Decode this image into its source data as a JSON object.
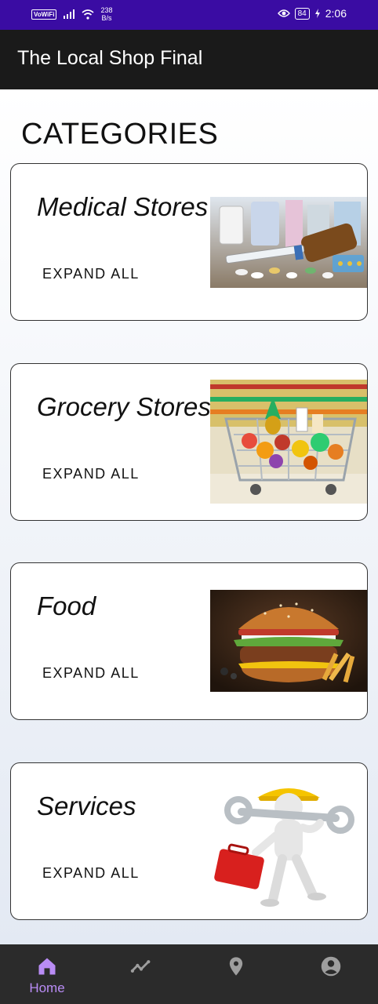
{
  "status_bar": {
    "wifi_badge": "VoWiFi",
    "speed_value": "238",
    "speed_unit": "B/s",
    "battery": "84",
    "time": "2:06"
  },
  "app_bar": {
    "title": "The Local Shop Final"
  },
  "section_title": "CATEGORIES",
  "categories": [
    {
      "title": "Medical Stores",
      "button": "EXPAND ALL",
      "image": "medicines-image"
    },
    {
      "title": "Grocery Stores",
      "button": "EXPAND ALL",
      "image": "grocery-cart-image"
    },
    {
      "title": "Food",
      "button": "EXPAND ALL",
      "image": "burger-image"
    },
    {
      "title": "Services",
      "button": "EXPAND ALL",
      "image": "repairman-image"
    }
  ],
  "bottom_nav": [
    {
      "label": "Home",
      "icon": "home-icon",
      "active": true
    },
    {
      "label": "",
      "icon": "trending-icon",
      "active": false
    },
    {
      "label": "",
      "icon": "location-pin-icon",
      "active": false
    },
    {
      "label": "",
      "icon": "account-icon",
      "active": false
    }
  ],
  "colors": {
    "status_bar": "#3a0ca3",
    "app_bar": "#1a1a1a",
    "nav_bar": "#2b2b2b",
    "nav_active": "#b98cf5",
    "nav_inactive": "#9e9e9e"
  }
}
